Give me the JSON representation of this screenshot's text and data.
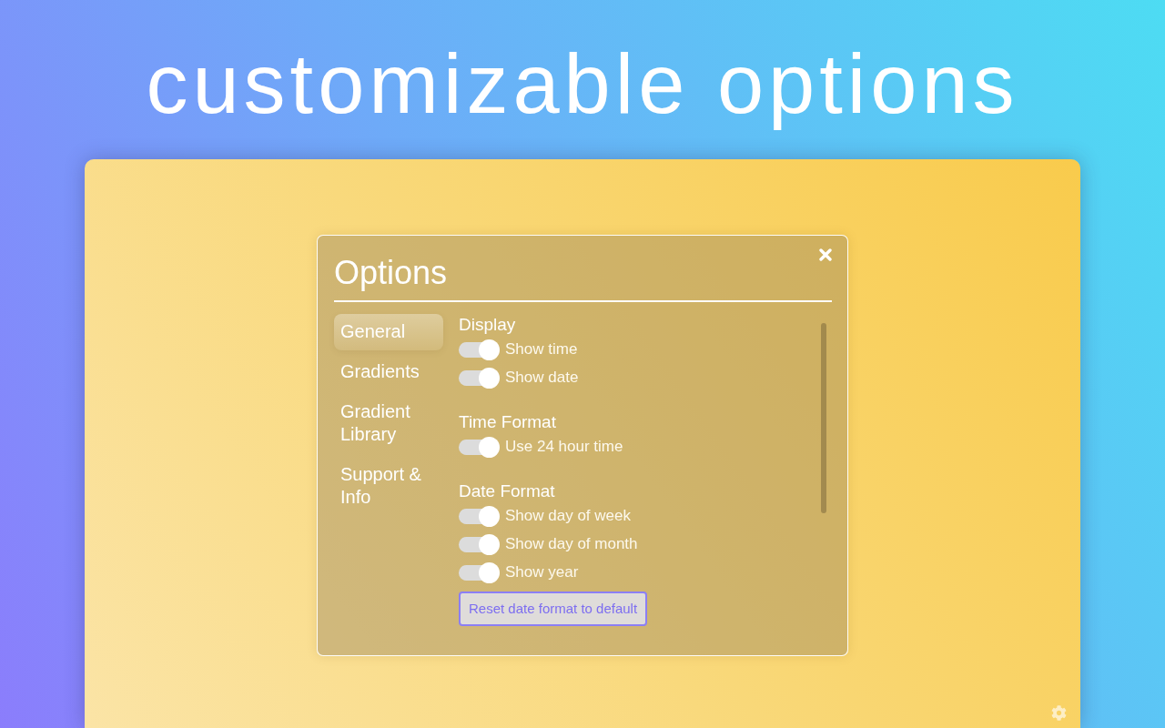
{
  "headline": "customizable options",
  "dialog": {
    "title": "Options",
    "nav": [
      {
        "label": "General",
        "selected": true
      },
      {
        "label": "Gradients",
        "selected": false
      },
      {
        "label": "Gradient Library",
        "selected": false
      },
      {
        "label": "Support & Info",
        "selected": false
      }
    ],
    "sections": [
      {
        "title": "Display",
        "toggles": [
          {
            "label": "Show time",
            "on": true
          },
          {
            "label": "Show date",
            "on": true
          }
        ]
      },
      {
        "title": "Time Format",
        "toggles": [
          {
            "label": "Use 24 hour time",
            "on": true
          }
        ]
      },
      {
        "title": "Date Format",
        "toggles": [
          {
            "label": "Show day of week",
            "on": true
          },
          {
            "label": "Show day of month",
            "on": true
          },
          {
            "label": "Show year",
            "on": true
          }
        ],
        "button": "Reset date format to default"
      }
    ]
  }
}
